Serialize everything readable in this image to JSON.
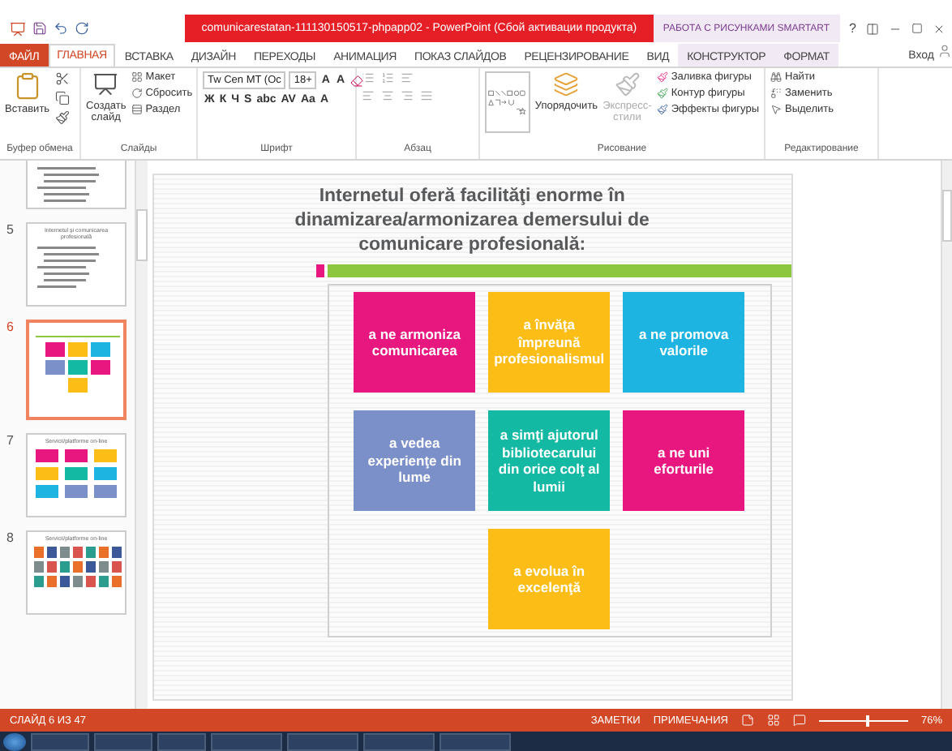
{
  "window": {
    "title": "comunicarestatan-111130150517-phpapp02 - PowerPoint (Сбой активации продукта)",
    "context_label": "РАБОТА С РИСУНКАМИ SMARTART",
    "help": "?"
  },
  "tabs": [
    {
      "label": "ФАЙЛ",
      "kind": "file",
      "selected": false
    },
    {
      "label": "ГЛАВНАЯ",
      "kind": "normal",
      "selected": true
    },
    {
      "label": "ВСТАВКА",
      "kind": "normal",
      "selected": false
    },
    {
      "label": "ДИЗАЙН",
      "kind": "normal",
      "selected": false
    },
    {
      "label": "ПЕРЕХОДЫ",
      "kind": "normal",
      "selected": false
    },
    {
      "label": "АНИМАЦИЯ",
      "kind": "normal",
      "selected": false
    },
    {
      "label": "ПОКАЗ СЛАЙДОВ",
      "kind": "normal",
      "selected": false
    },
    {
      "label": "РЕЦЕНЗИРОВАНИЕ",
      "kind": "normal",
      "selected": false
    },
    {
      "label": "ВИД",
      "kind": "normal",
      "selected": false
    },
    {
      "label": "КОНСТРУКТОР",
      "kind": "context",
      "selected": false
    },
    {
      "label": "ФОРМАТ",
      "kind": "context",
      "selected": false
    }
  ],
  "signin": "Вход",
  "ribbon": {
    "clipboard": {
      "label": "Буфер обмена",
      "paste": "Вставить"
    },
    "slides": {
      "label": "Слайды",
      "new_slide": "Создать слайд",
      "small": [
        "Макет",
        "Сбросить",
        "Раздел"
      ]
    },
    "font": {
      "label": "Шрифт",
      "font_name": "Tw Cen MT (Oc",
      "font_size": "18+",
      "size_buttons": [
        "A",
        "A"
      ],
      "format_buttons": [
        "Ж",
        "К",
        "Ч",
        "S",
        "abc",
        "AV",
        "Aa",
        "A"
      ]
    },
    "paragraph": {
      "label": "Абзац"
    },
    "drawing": {
      "label": "Рисование",
      "arrange": "Упорядочить",
      "styles": "Экспресс-стили",
      "small": [
        "Заливка фигуры",
        "Контур фигуры",
        "Эффекты фигуры"
      ]
    },
    "editing": {
      "label": "Редактирование",
      "small": [
        "Найти",
        "Заменить",
        "Выделить"
      ]
    }
  },
  "thumbnails": [
    {
      "kind": "bullets",
      "selected": false
    },
    {
      "number": "5",
      "title": "Internetul şi comunicarea profesională",
      "kind": "bullets",
      "selected": false
    },
    {
      "number": "6",
      "kind": "tiles",
      "selected": true
    },
    {
      "number": "7",
      "title": "Servicii/platforme on-line",
      "kind": "grid",
      "selected": false
    },
    {
      "number": "8",
      "title": "Servicii/platforme on-line",
      "kind": "icons",
      "selected": false
    }
  ],
  "slide": {
    "title": "Internetul oferă facilităţi enorme în dinamizarea/armonizarea demersului de comunicare profesională:",
    "tiles": [
      {
        "text": "a ne armoniza comunicarea",
        "color": "#e8177f"
      },
      {
        "text": "a învăţa împreună profesionalismul",
        "color": "#fbbd16"
      },
      {
        "text": "a ne promova valorile",
        "color": "#1eb4e2"
      },
      {
        "text": "a vedea experienţe din lume",
        "color": "#7b8fc8"
      },
      {
        "text": "a simţi ajutorul bibliotecarului din orice colţ al lumii",
        "color": "#14b9a4"
      },
      {
        "text": "a ne uni eforturile",
        "color": "#e8177f"
      },
      {
        "text": "a evolua în excelenţă",
        "color": "#fbbd16"
      }
    ]
  },
  "status_bar": {
    "slide_counter": "СЛАЙД 6 ИЗ 47",
    "notes": "ЗАМЕТКИ",
    "comments": "ПРИМЕЧАНИЯ",
    "zoom": "76%",
    "level": 0.52
  }
}
